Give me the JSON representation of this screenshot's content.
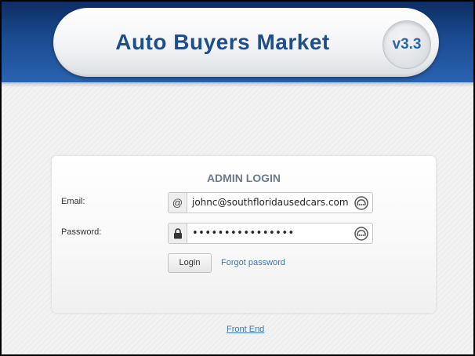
{
  "header": {
    "app_title": "Auto Buyers Market",
    "version": "v3.3"
  },
  "login": {
    "title": "ADMIN LOGIN",
    "email_label": "Email:",
    "email_icon": "@",
    "email_value": "johnc@southfloridausedcars.com",
    "password_label": "Password:",
    "password_value": "••••••••••••••••",
    "login_button": "Login",
    "forgot_link": "Forgot password"
  },
  "footer": {
    "front_end_link": "Front End"
  },
  "colors": {
    "header_bg": "#1a4b91",
    "title_text": "#1f4e8c",
    "version_text": "#2a66a8",
    "panel_title": "#6b7b8c",
    "link": "#3b78b8"
  },
  "icons": [
    "at-sign-icon",
    "lock-icon",
    "password-manager-key-icon"
  ]
}
